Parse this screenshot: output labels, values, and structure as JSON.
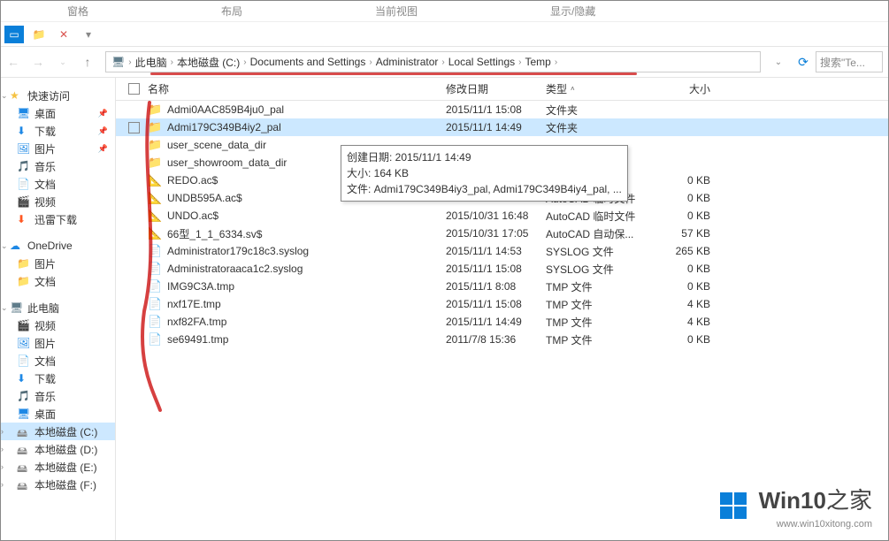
{
  "ribbon": {
    "tabs": [
      "窗格",
      "布局",
      "当前视图",
      "显示/隐藏"
    ]
  },
  "nav": {
    "refresh": "⟳",
    "dropdown": "⌄"
  },
  "breadcrumb": [
    "此电脑",
    "本地磁盘 (C:)",
    "Documents and Settings",
    "Administrator",
    "Local Settings",
    "Temp"
  ],
  "search": {
    "placeholder": "搜索\"Te..."
  },
  "sidebar": {
    "quick": {
      "label": "快速访问",
      "items": [
        "桌面",
        "下载",
        "图片",
        "音乐",
        "文档",
        "视频",
        "迅雷下载"
      ]
    },
    "onedrive": {
      "label": "OneDrive",
      "items": [
        "图片",
        "文档"
      ]
    },
    "thispc": {
      "label": "此电脑",
      "items": [
        "视频",
        "图片",
        "文档",
        "下载",
        "音乐",
        "桌面",
        "本地磁盘 (C:)",
        "本地磁盘 (D:)",
        "本地磁盘 (E:)",
        "本地磁盘 (F:)"
      ]
    }
  },
  "columns": {
    "name": "名称",
    "date": "修改日期",
    "type": "类型",
    "size": "大小"
  },
  "rows": [
    {
      "icon": "folder",
      "name": "Admi0AAC859B4ju0_pal",
      "date": "2015/11/1 15:08",
      "type": "文件夹",
      "size": ""
    },
    {
      "icon": "folder",
      "name": "Admi179C349B4iy2_pal",
      "date": "2015/11/1 14:49",
      "type": "文件夹",
      "size": "",
      "selected": true
    },
    {
      "icon": "folder",
      "name": "user_scene_data_dir",
      "date": "",
      "type": "",
      "size": ""
    },
    {
      "icon": "folder",
      "name": "user_showroom_data_dir",
      "date": "",
      "type": "",
      "size": ""
    },
    {
      "icon": "dwg",
      "name": "REDO.ac$",
      "date": "",
      "type": "件",
      "size": "0 KB"
    },
    {
      "icon": "dwg",
      "name": "UNDB595A.ac$",
      "date": "2015/10/31 16:55",
      "type": "AutoCAD 临时文件",
      "size": "0 KB"
    },
    {
      "icon": "dwg",
      "name": "UNDO.ac$",
      "date": "2015/10/31 16:48",
      "type": "AutoCAD 临时文件",
      "size": "0 KB"
    },
    {
      "icon": "dwg",
      "name": "66型_1_1_6334.sv$",
      "date": "2015/10/31 17:05",
      "type": "AutoCAD 自动保...",
      "size": "57 KB"
    },
    {
      "icon": "file",
      "name": "Administrator179c18c3.syslog",
      "date": "2015/11/1 14:53",
      "type": "SYSLOG 文件",
      "size": "265 KB"
    },
    {
      "icon": "file",
      "name": "Administratoraaca1c2.syslog",
      "date": "2015/11/1 15:08",
      "type": "SYSLOG 文件",
      "size": "0 KB"
    },
    {
      "icon": "file",
      "name": "IMG9C3A.tmp",
      "date": "2015/11/1 8:08",
      "type": "TMP 文件",
      "size": "0 KB"
    },
    {
      "icon": "file",
      "name": "nxf17E.tmp",
      "date": "2015/11/1 15:08",
      "type": "TMP 文件",
      "size": "4 KB"
    },
    {
      "icon": "file",
      "name": "nxf82FA.tmp",
      "date": "2015/11/1 14:49",
      "type": "TMP 文件",
      "size": "4 KB"
    },
    {
      "icon": "file",
      "name": "se69491.tmp",
      "date": "2011/7/8 15:36",
      "type": "TMP 文件",
      "size": "0 KB"
    }
  ],
  "tooltip": {
    "l1": "创建日期: 2015/11/1 14:49",
    "l2": "大小: 164 KB",
    "l3": "文件: Admi179C349B4iy3_pal, Admi179C349B4iy4_pal, ..."
  },
  "logo": {
    "text1": "Win10",
    "text2": "之家",
    "url": "www.win10xitong.com"
  }
}
